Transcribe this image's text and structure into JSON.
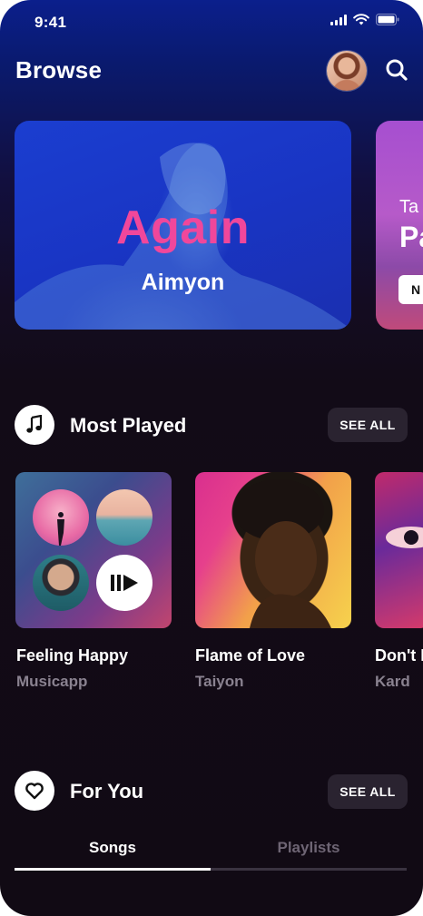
{
  "status_bar": {
    "time": "9:41"
  },
  "header": {
    "title": "Browse"
  },
  "featured": [
    {
      "title": "Again",
      "artist": "Aimyon"
    },
    {
      "subtitle": "Ta",
      "title": "Pa",
      "button_label": "N"
    }
  ],
  "most_played": {
    "title": "Most Played",
    "see_all_label": "SEE ALL",
    "items": [
      {
        "title": "Feeling Happy",
        "artist": "Musicapp"
      },
      {
        "title": "Flame of Love",
        "artist": "Taiyon"
      },
      {
        "title": "Don't F",
        "artist": "Kard"
      }
    ]
  },
  "for_you": {
    "title": "For You",
    "see_all_label": "SEE ALL",
    "tabs": [
      {
        "label": "Songs",
        "active": true
      },
      {
        "label": "Playlists",
        "active": false
      }
    ]
  },
  "colors": {
    "accent_pink": "#f0479b",
    "background": "#110a14",
    "featured_blue": "#1b3ed0"
  }
}
